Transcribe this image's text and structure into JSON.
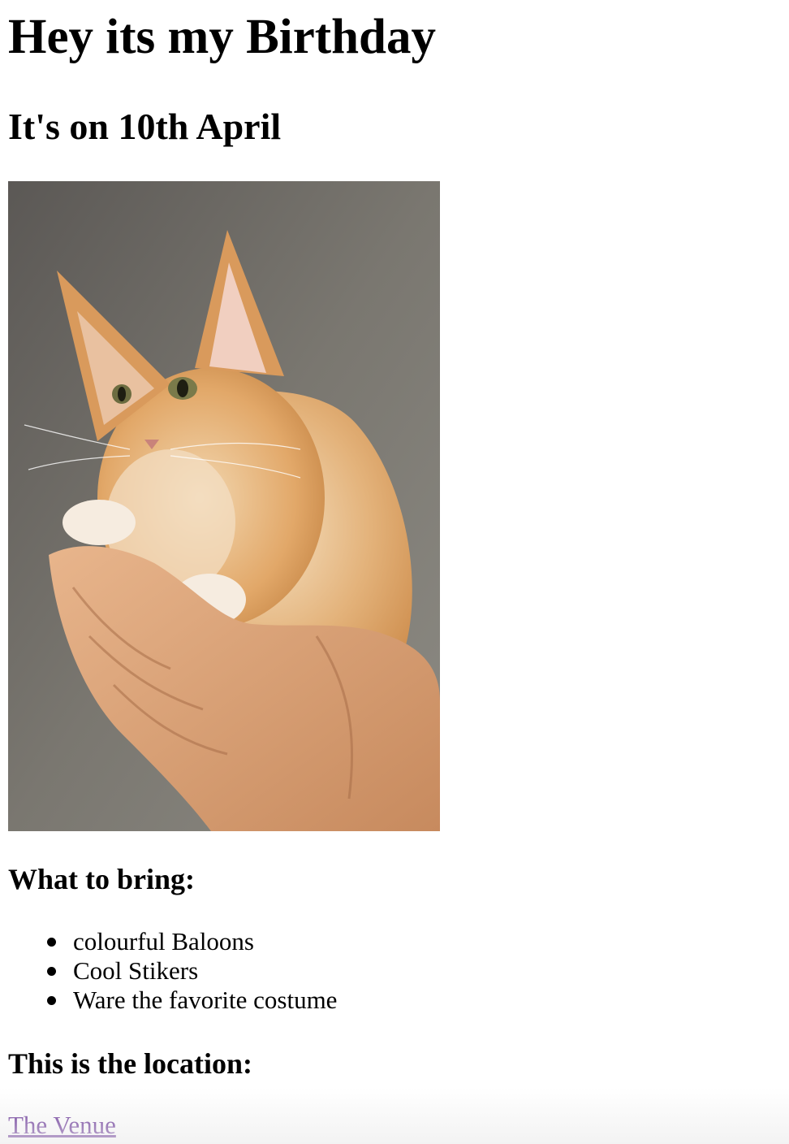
{
  "page": {
    "title": "Hey its my Birthday",
    "subtitle": "It's on 10th April"
  },
  "photo": {
    "subject": "kitten-in-hands"
  },
  "bring": {
    "heading": "What to bring:",
    "items": [
      "colourful Baloons",
      "Cool Stikers",
      "Ware the favorite costume"
    ]
  },
  "location": {
    "heading": "This is the location:",
    "link_text": "The Venue"
  },
  "colors": {
    "text": "#000000",
    "visited_link": "#551a8b",
    "background": "#ffffff"
  }
}
